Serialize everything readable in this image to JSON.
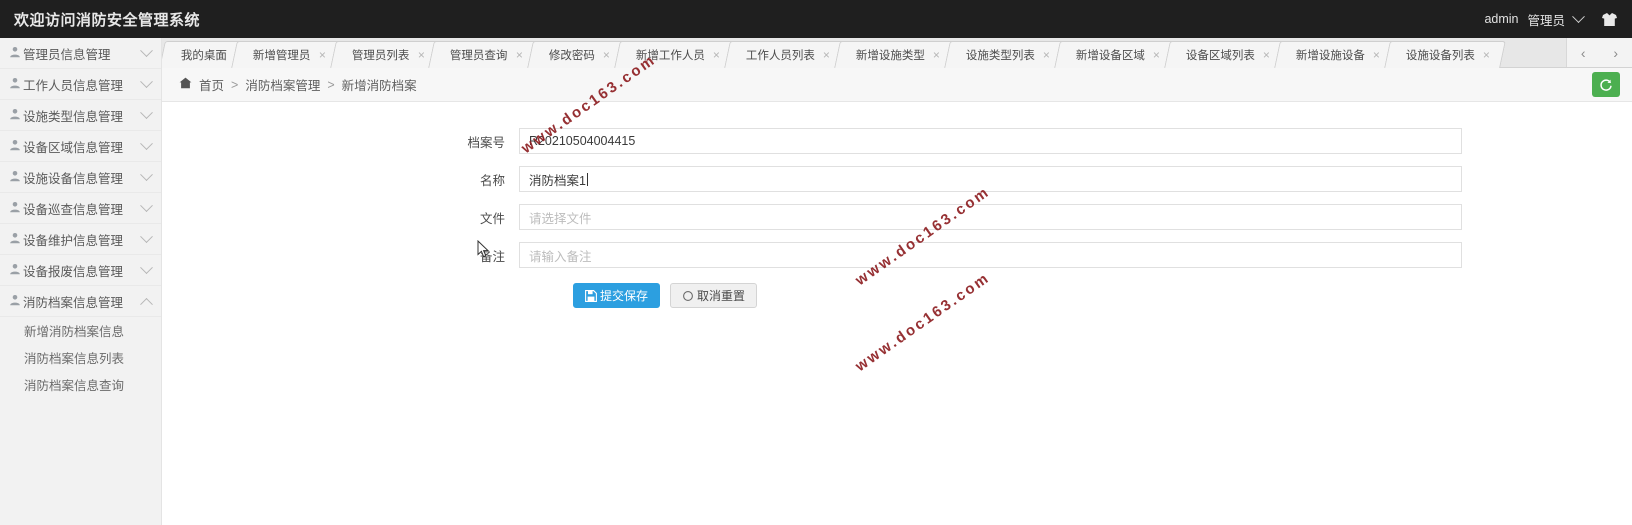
{
  "header": {
    "title": "欢迎访问消防安全管理系统",
    "user": "admin",
    "role": "管理员",
    "caret_icon": "chevron-down-icon",
    "avatar_icon": "shirt-icon"
  },
  "sidebar": {
    "items": [
      {
        "label": "管理员信息管理",
        "icon": "person-icon",
        "expanded": false
      },
      {
        "label": "工作人员信息管理",
        "icon": "person-icon",
        "expanded": false
      },
      {
        "label": "设施类型信息管理",
        "icon": "person-icon",
        "expanded": false
      },
      {
        "label": "设备区域信息管理",
        "icon": "person-icon",
        "expanded": false
      },
      {
        "label": "设施设备信息管理",
        "icon": "person-icon",
        "expanded": false
      },
      {
        "label": "设备巡查信息管理",
        "icon": "person-icon",
        "expanded": false
      },
      {
        "label": "设备维护信息管理",
        "icon": "person-icon",
        "expanded": false
      },
      {
        "label": "设备报废信息管理",
        "icon": "person-icon",
        "expanded": false
      },
      {
        "label": "消防档案信息管理",
        "icon": "person-icon",
        "expanded": true
      }
    ],
    "submenu": [
      {
        "label": "新增消防档案信息"
      },
      {
        "label": "消防档案信息列表"
      },
      {
        "label": "消防档案信息查询"
      }
    ],
    "collapse_icon": "triangle-left-icon"
  },
  "tabs": {
    "items": [
      {
        "label": "我的桌面",
        "closable": false,
        "active": false
      },
      {
        "label": "新增管理员",
        "closable": true,
        "active": false
      },
      {
        "label": "管理员列表",
        "closable": true,
        "active": false
      },
      {
        "label": "管理员查询",
        "closable": true,
        "active": false
      },
      {
        "label": "修改密码",
        "closable": true,
        "active": false
      },
      {
        "label": "新增工作人员",
        "closable": true,
        "active": false
      },
      {
        "label": "工作人员列表",
        "closable": true,
        "active": false
      },
      {
        "label": "新增设施类型",
        "closable": true,
        "active": false
      },
      {
        "label": "设施类型列表",
        "closable": true,
        "active": false
      },
      {
        "label": "新增设备区域",
        "closable": true,
        "active": false
      },
      {
        "label": "设备区域列表",
        "closable": true,
        "active": false
      },
      {
        "label": "新增设施设备",
        "closable": true,
        "active": false
      },
      {
        "label": "设施设备列表",
        "closable": true,
        "active": false
      }
    ],
    "close_glyph": "×",
    "prev_glyph": "‹",
    "next_glyph": "›",
    "prev_icon": "chevron-left-icon",
    "next_icon": "chevron-right-icon"
  },
  "breadcrumb": {
    "home_icon": "home-icon",
    "items": [
      "首页",
      "消防档案管理",
      "新增消防档案"
    ],
    "separator": ">",
    "refresh_icon": "refresh-icon"
  },
  "form": {
    "fields": [
      {
        "label": "档案号",
        "value": "R20210504004415",
        "placeholder": "",
        "focused": false
      },
      {
        "label": "名称",
        "value": "消防档案1",
        "placeholder": "",
        "focused": true
      },
      {
        "label": "文件",
        "value": "",
        "placeholder": "请选择文件",
        "focused": false
      },
      {
        "label": "备注",
        "value": "",
        "placeholder": "请输入备注",
        "focused": false
      }
    ],
    "submit_label": "提交保存",
    "submit_icon": "save-disk-icon",
    "reset_label": "取消重置",
    "reset_icon": "reset-circle-icon"
  },
  "watermarks": [
    "www.doc163.com",
    "www.doc163.com",
    "www.doc163.com"
  ],
  "colors": {
    "header_bg": "#1f1f1f",
    "sidebar_bg": "#f2f2f2",
    "primary_button": "#2c9fe0",
    "refresh_green": "#4caf50",
    "watermark": "#8e1f22"
  }
}
